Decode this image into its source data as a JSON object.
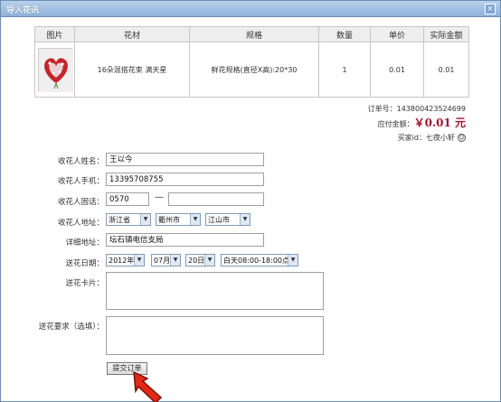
{
  "window": {
    "title": "导入花讯",
    "close_glyph": "×"
  },
  "items_table": {
    "headers": [
      "图片",
      "花材",
      "规格",
      "数量",
      "单价",
      "实际金额"
    ],
    "row": {
      "product": "16朵混搭花束 满天星",
      "spec": "鲜花规格(直径X高):20*30",
      "quantity": "1",
      "unit_price": "0.01",
      "amount": "0.01"
    }
  },
  "summary": {
    "order_label": "订单号：",
    "order_no": "143800423524699",
    "payable_label": "应付金额：",
    "payable": "￥0.01 元",
    "buyer_label": "买家id：",
    "buyer": "七夜小轩"
  },
  "form": {
    "recipient_name_label": "收花人姓名：",
    "recipient_name": "王以今",
    "phone_label": "收花人手机：",
    "phone": "13395708755",
    "tel_label": "收花人固话：",
    "tel_area": "0570",
    "tel_dash": "—",
    "tel_number": "",
    "address_label": "收花人地址：",
    "province": "浙江省",
    "city": "衢州市",
    "county": "江山市",
    "detail_label": "详细地址：",
    "detail": "坛石镇电信支局",
    "date_label": "送花日期：",
    "year": "2012年",
    "month": "07月",
    "day": "20日",
    "time_slot": "白天08:00-18:00点",
    "card_label": "送花卡片：",
    "requirements_label": "送花要求（选填）：",
    "submit_label": "提交订单"
  },
  "icons": {
    "dropdown": "▼"
  }
}
